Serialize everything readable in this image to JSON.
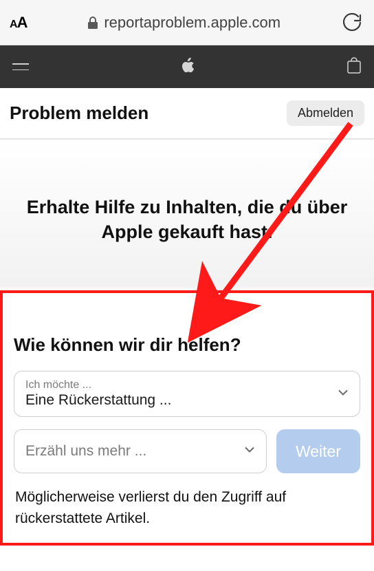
{
  "browser": {
    "url": "reportaproblem.apple.com"
  },
  "header": {
    "title": "Problem melden",
    "logout_label": "Abmelden"
  },
  "banner": {
    "text": "Erhalte Hilfe zu Inhalten, die du über Apple gekauft hast."
  },
  "form": {
    "heading": "Wie können wir dir helfen?",
    "field1": {
      "hint": "Ich möchte ...",
      "value": "Eine Rückerstattung ..."
    },
    "field2": {
      "placeholder": "Erzähl uns mehr ..."
    },
    "next_label": "Weiter",
    "footnote": "Möglicherweise verlierst du den Zugriff auf rückerstattete Artikel."
  },
  "annotation": {
    "arrow_color": "#ff1a1a"
  }
}
